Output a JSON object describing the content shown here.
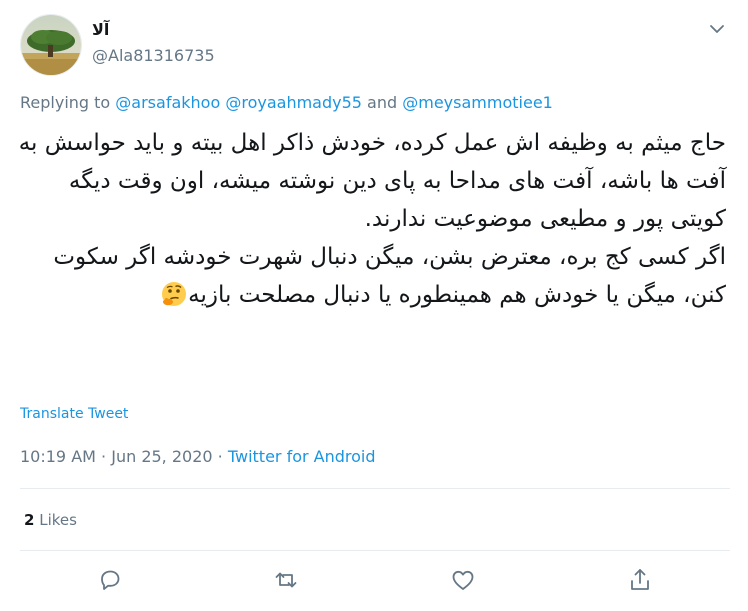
{
  "user": {
    "name": "آلا",
    "handle": "@Ala81316735"
  },
  "reply": {
    "prefix": "Replying to",
    "mention1": "@arsafakhoo",
    "mention2": "@royaahmady55",
    "and": "and",
    "mention3": "@meysammotiee1"
  },
  "tweet": {
    "text": "حاج میثم به وظیفه اش عمل کرده، خودش ذاکر اهل بیته و باید حواسش به آفت ها باشه، آفت های مداحا به پای دین نوشته میشه، اون وقت دیگه کویتی پور و مطیعی موضوعیت ندارند.\nاگر کسی کج بره، معترض بشن، میگن دنبال شهرت خودشه اگر سکوت کنن، میگن یا خودش هم همینطوره یا دنبال مصلحت بازیه",
    "emoji": "thinking-face-icon",
    "translate": "Translate Tweet"
  },
  "meta": {
    "time": "10:19 AM",
    "sep": "·",
    "date": "Jun 25, 2020",
    "source": "Twitter for Android"
  },
  "stats": {
    "likes_count": "2",
    "likes_label": "Likes"
  },
  "colors": {
    "link": "#1b95e0",
    "muted": "#657786",
    "text": "#14171a",
    "divider": "#e6ecf0"
  },
  "icons": {
    "reply": "reply-icon",
    "retweet": "retweet-icon",
    "like": "heart-icon",
    "share": "share-icon",
    "caret": "chevron-down-icon"
  }
}
